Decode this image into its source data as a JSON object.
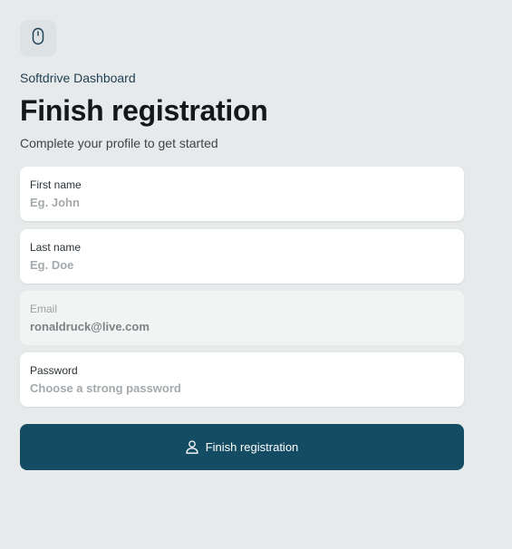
{
  "app": {
    "name": "Softdrive Dashboard",
    "logo_icon": "mouse-icon"
  },
  "header": {
    "title": "Finish registration",
    "subtitle": "Complete your profile to get started"
  },
  "form": {
    "first_name": {
      "label": "First name",
      "placeholder": "Eg. John",
      "value": ""
    },
    "last_name": {
      "label": "Last name",
      "placeholder": "Eg. Doe",
      "value": ""
    },
    "email": {
      "label": "Email",
      "value": "ronaldruck@live.com",
      "disabled": true
    },
    "password": {
      "label": "Password",
      "placeholder": "Choose a strong password",
      "value": ""
    },
    "submit": {
      "label": "Finish registration",
      "icon": "user-icon"
    }
  },
  "colors": {
    "background": "#e7eaeb",
    "accent": "#134c63",
    "field_background": "#ffffff",
    "field_disabled_background": "#f2f4f4"
  }
}
